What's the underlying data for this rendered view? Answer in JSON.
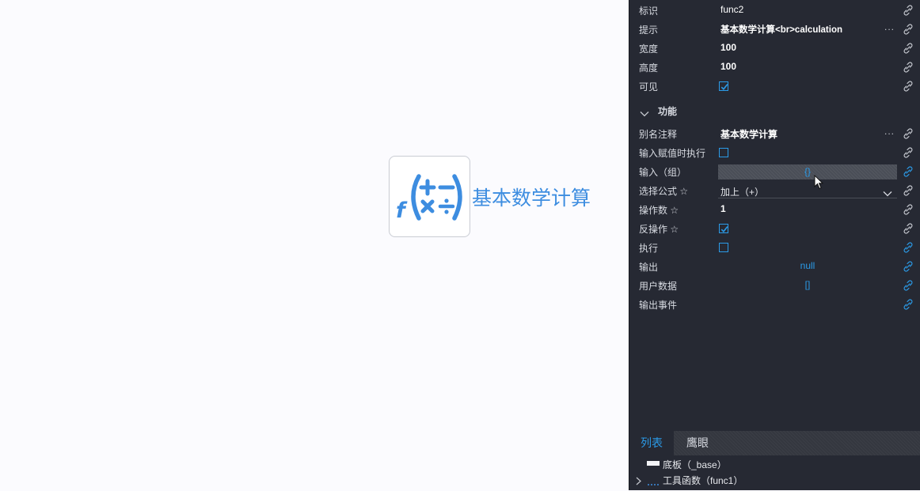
{
  "canvas": {
    "node": {
      "label": "基本数学计算",
      "icon": "math-function-icon",
      "icon_letter": "f"
    }
  },
  "properties": {
    "rows_top": [
      {
        "id": "id",
        "label": "标识",
        "value": "func2",
        "type": "text"
      },
      {
        "id": "tip",
        "label": "提示",
        "value": "基本数学计算<br>calculation",
        "type": "text",
        "more": "..."
      },
      {
        "id": "width",
        "label": "宽度",
        "value": "100",
        "type": "text",
        "bold": true
      },
      {
        "id": "height",
        "label": "高度",
        "value": "100",
        "type": "text",
        "bold": true
      },
      {
        "id": "visible",
        "label": "可见",
        "checked": true,
        "type": "checkbox"
      }
    ],
    "section": {
      "title": "功能",
      "expanded": true
    },
    "rows_func": [
      {
        "id": "alias",
        "label": "别名注释",
        "value": "基本数学计算",
        "type": "text",
        "more": "..."
      },
      {
        "id": "exec_on_input",
        "label": "输入赋值时执行",
        "checked": false,
        "type": "checkbox"
      },
      {
        "id": "inputs",
        "label": "输入（组）",
        "value": "{}",
        "type": "inputbox"
      },
      {
        "id": "formula",
        "label": "选择公式 ☆",
        "value": "加上（+）",
        "type": "select"
      },
      {
        "id": "operands",
        "label": "操作数 ☆",
        "value": "1",
        "type": "text",
        "bold": true
      },
      {
        "id": "reverse",
        "label": "反操作 ☆",
        "checked": true,
        "type": "checkbox"
      },
      {
        "id": "execute",
        "label": "执行",
        "checked": false,
        "type": "checkbox",
        "link_active": true
      },
      {
        "id": "output",
        "label": "输出",
        "value": "null",
        "type": "center",
        "link_active": true
      },
      {
        "id": "userdata",
        "label": "用户数据",
        "value": "[]",
        "type": "center",
        "link_active": true
      },
      {
        "id": "outevent",
        "label": "输出事件",
        "type": "empty",
        "link_active": true
      }
    ]
  },
  "bottom": {
    "tabs": [
      {
        "label": "列表",
        "active": true
      },
      {
        "label": "鹰眼",
        "active": false
      }
    ],
    "tree": [
      {
        "label": "底板（_base）",
        "icon": "panel-icon",
        "expandable": false
      },
      {
        "label": "工具函数（func1）",
        "icon": "function-icon",
        "expandable": true
      }
    ]
  },
  "colors": {
    "accent": "#2b9be8",
    "panel_bg": "#262933",
    "node_icon": "#3d8de0"
  }
}
